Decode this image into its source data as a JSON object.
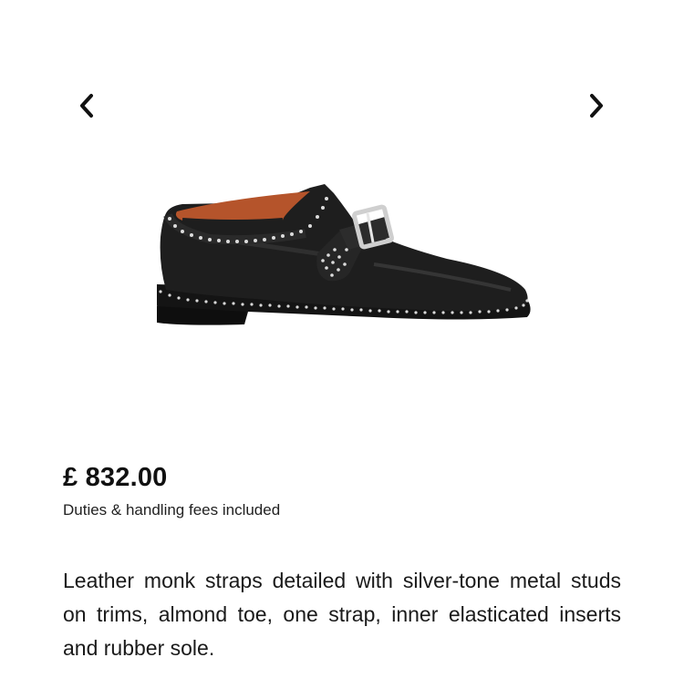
{
  "carousel": {
    "prev_icon": "chevron-left-icon",
    "next_icon": "chevron-right-icon",
    "image": "studded-leather-monk-strap-shoe"
  },
  "product": {
    "price": "£ 832.00",
    "duties_note": "Duties & handling fees included",
    "description": "Leather monk straps detailed with silver-tone metal studs on trims, almond toe, one strap, inner elasticated inserts and rubber sole."
  },
  "colors": {
    "text": "#1a1a1a",
    "background": "#ffffff",
    "leather": "#1b1b1b",
    "lining": "#b5542b",
    "studs": "#d9d9d9"
  }
}
